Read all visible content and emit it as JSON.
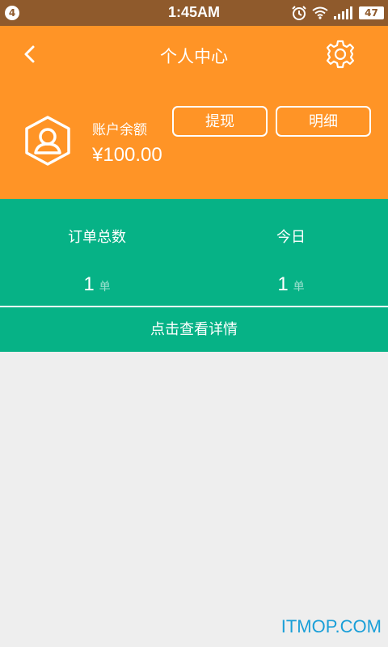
{
  "status_bar": {
    "notification_count": "4",
    "time": "1:45AM",
    "battery": "47"
  },
  "header": {
    "title": "个人中心",
    "back_icon": "chevron-left-icon",
    "settings_icon": "gear-icon"
  },
  "account": {
    "avatar_icon": "user-avatar-icon",
    "balance_label": "账户余额",
    "balance_value": "¥100.00",
    "withdraw_label": "提现",
    "detail_label": "明细"
  },
  "stats": {
    "total_orders_label": "订单总数",
    "total_orders_value": "1",
    "total_orders_unit": "单",
    "today_label": "今日",
    "today_value": "1",
    "today_unit": "单",
    "view_details_label": "点击查看详情"
  },
  "watermark": "ITMOP.COM",
  "colors": {
    "header_bg": "#ff9426",
    "stats_bg": "#06b286",
    "status_bar_bg": "#8f5a2c",
    "page_bg": "#eeeeee"
  }
}
